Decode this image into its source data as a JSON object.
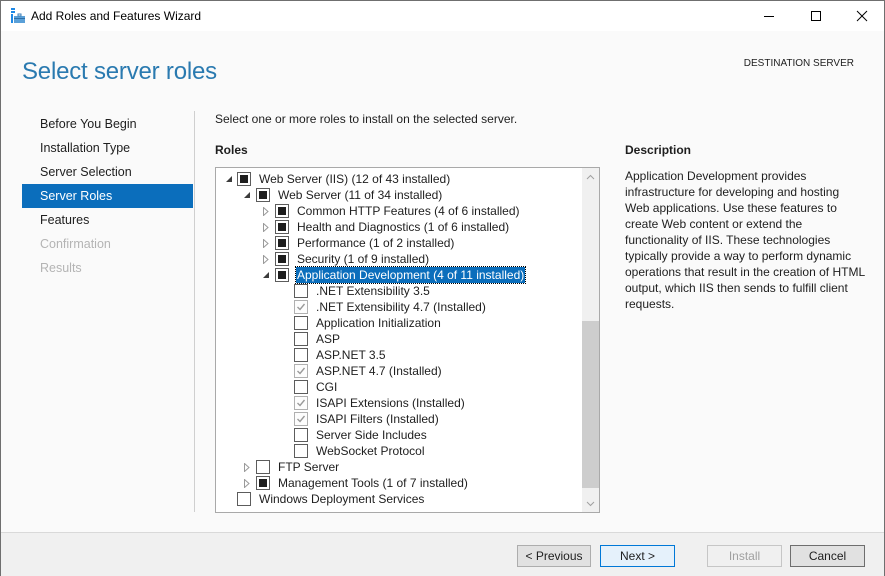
{
  "window": {
    "title": "Add Roles and Features Wizard",
    "icon": "server-manager-briefcase-icon",
    "controls": {
      "minimize": "minimize-icon",
      "maximize": "maximize-icon",
      "close": "close-icon"
    }
  },
  "header": {
    "title": "Select server roles",
    "destination_label": "DESTINATION SERVER"
  },
  "nav": {
    "items": [
      {
        "label": "Before You Begin",
        "state": "normal"
      },
      {
        "label": "Installation Type",
        "state": "normal"
      },
      {
        "label": "Server Selection",
        "state": "normal"
      },
      {
        "label": "Server Roles",
        "state": "active"
      },
      {
        "label": "Features",
        "state": "normal"
      },
      {
        "label": "Confirmation",
        "state": "disabled"
      },
      {
        "label": "Results",
        "state": "disabled"
      }
    ]
  },
  "main": {
    "instruction": "Select one or more roles to install on the selected server.",
    "roles_heading": "Roles",
    "roles": [
      {
        "label": "Web Server (IIS) (12 of 43 installed)",
        "level": 0,
        "expander": "expanded",
        "check": "partial"
      },
      {
        "label": "Web Server (11 of 34 installed)",
        "level": 1,
        "expander": "expanded",
        "check": "partial"
      },
      {
        "label": "Common HTTP Features (4 of 6 installed)",
        "level": 2,
        "expander": "collapsed",
        "check": "partial"
      },
      {
        "label": "Health and Diagnostics (1 of 6 installed)",
        "level": 2,
        "expander": "collapsed",
        "check": "partial"
      },
      {
        "label": "Performance (1 of 2 installed)",
        "level": 2,
        "expander": "collapsed",
        "check": "partial"
      },
      {
        "label": "Security (1 of 9 installed)",
        "level": 2,
        "expander": "collapsed",
        "check": "partial"
      },
      {
        "label": "Application Development (4 of 11 installed)",
        "level": 2,
        "expander": "expanded",
        "check": "partial",
        "selected": true
      },
      {
        "label": ".NET Extensibility 3.5",
        "level": 3,
        "expander": "none",
        "check": "unchecked"
      },
      {
        "label": ".NET Extensibility 4.7 (Installed)",
        "level": 3,
        "expander": "none",
        "check": "checked-disabled"
      },
      {
        "label": "Application Initialization",
        "level": 3,
        "expander": "none",
        "check": "unchecked"
      },
      {
        "label": "ASP",
        "level": 3,
        "expander": "none",
        "check": "unchecked"
      },
      {
        "label": "ASP.NET 3.5",
        "level": 3,
        "expander": "none",
        "check": "unchecked"
      },
      {
        "label": "ASP.NET 4.7 (Installed)",
        "level": 3,
        "expander": "none",
        "check": "checked-disabled"
      },
      {
        "label": "CGI",
        "level": 3,
        "expander": "none",
        "check": "unchecked"
      },
      {
        "label": "ISAPI Extensions (Installed)",
        "level": 3,
        "expander": "none",
        "check": "checked-disabled"
      },
      {
        "label": "ISAPI Filters (Installed)",
        "level": 3,
        "expander": "none",
        "check": "checked-disabled"
      },
      {
        "label": "Server Side Includes",
        "level": 3,
        "expander": "none",
        "check": "unchecked"
      },
      {
        "label": "WebSocket Protocol",
        "level": 3,
        "expander": "none",
        "check": "unchecked"
      },
      {
        "label": "FTP Server",
        "level": 1,
        "expander": "collapsed",
        "check": "unchecked"
      },
      {
        "label": "Management Tools (1 of 7 installed)",
        "level": 1,
        "expander": "collapsed",
        "check": "partial"
      },
      {
        "label": "Windows Deployment Services",
        "level": 0,
        "expander": "none",
        "check": "unchecked"
      }
    ]
  },
  "description": {
    "heading": "Description",
    "text": "Application Development provides infrastructure for developing and hosting Web applications. Use these features to create Web content or extend the functionality of IIS. These technologies typically provide a way to perform dynamic operations that result in the creation of HTML output, which IIS then sends to fulfill client requests."
  },
  "footer": {
    "previous_label": "< Previous",
    "next_label": "Next >",
    "install_label": "Install",
    "cancel_label": "Cancel"
  },
  "colors": {
    "accent": "#0b6ebc",
    "header_title": "#2a7ab0",
    "disabled_text": "#b4b4b4"
  }
}
